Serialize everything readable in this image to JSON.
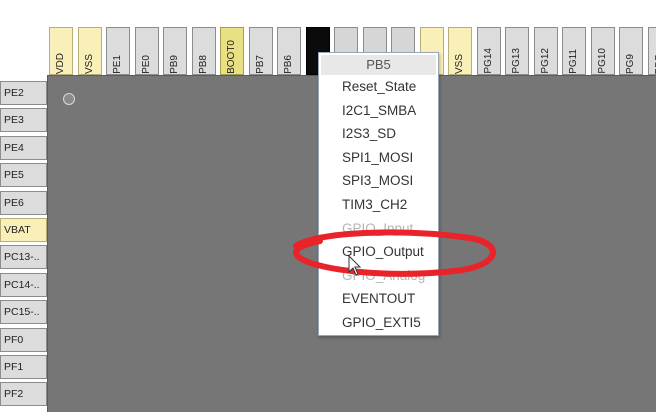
{
  "top_pins": [
    {
      "label": "VDD",
      "style": "power"
    },
    {
      "label": "VSS",
      "style": "power"
    },
    {
      "label": "PE1",
      "style": "normal"
    },
    {
      "label": "PE0",
      "style": "normal"
    },
    {
      "label": "PB9",
      "style": "normal"
    },
    {
      "label": "PB8",
      "style": "normal"
    },
    {
      "label": "BOOT0",
      "style": "boot"
    },
    {
      "label": "PB7",
      "style": "normal"
    },
    {
      "label": "PB6",
      "style": "normal"
    },
    {
      "label": "",
      "style": "black"
    },
    {
      "label": "",
      "style": "grey"
    },
    {
      "label": "",
      "style": "grey"
    },
    {
      "label": "5",
      "style": "grey"
    },
    {
      "label": "",
      "style": "power"
    },
    {
      "label": "VSS",
      "style": "power"
    },
    {
      "label": "PG14",
      "style": "normal"
    },
    {
      "label": "PG13",
      "style": "normal"
    },
    {
      "label": "PG12",
      "style": "normal"
    },
    {
      "label": "PG11",
      "style": "normal"
    },
    {
      "label": "PG10",
      "style": "normal"
    },
    {
      "label": "PG9",
      "style": "normal"
    },
    {
      "label": "PD7",
      "style": "normal"
    }
  ],
  "left_pins": [
    {
      "label": "PE2",
      "style": "normal"
    },
    {
      "label": "PE3",
      "style": "normal"
    },
    {
      "label": "PE4",
      "style": "normal"
    },
    {
      "label": "PE5",
      "style": "normal"
    },
    {
      "label": "PE6",
      "style": "normal"
    },
    {
      "label": "VBAT",
      "style": "power"
    },
    {
      "label": "PC13-..",
      "style": "normal"
    },
    {
      "label": "PC14-..",
      "style": "normal"
    },
    {
      "label": "PC15-..",
      "style": "normal"
    },
    {
      "label": "PF0",
      "style": "normal"
    },
    {
      "label": "PF1",
      "style": "normal"
    },
    {
      "label": "PF2",
      "style": "normal"
    }
  ],
  "pin_menu": {
    "title": "PB5",
    "items": [
      {
        "label": "Reset_State",
        "dim": false
      },
      {
        "label": "I2C1_SMBA",
        "dim": false
      },
      {
        "label": "I2S3_SD",
        "dim": false
      },
      {
        "label": "SPI1_MOSI",
        "dim": false
      },
      {
        "label": "SPI3_MOSI",
        "dim": false
      },
      {
        "label": "TIM3_CH2",
        "dim": false
      },
      {
        "label": "GPIO_Input",
        "dim": true
      },
      {
        "label": "GPIO_Output",
        "dim": false
      },
      {
        "label": "GPIO_Analog",
        "dim": true
      },
      {
        "label": "EVENTOUT",
        "dim": false
      },
      {
        "label": "GPIO_EXTI5",
        "dim": false
      }
    ]
  },
  "colors": {
    "chip_body": "#767676",
    "pin_default": "#dcdcdc",
    "pin_power": "#f9efb8",
    "pin_boot": "#e9e083",
    "highlight_ellipse": "#e8242a"
  }
}
